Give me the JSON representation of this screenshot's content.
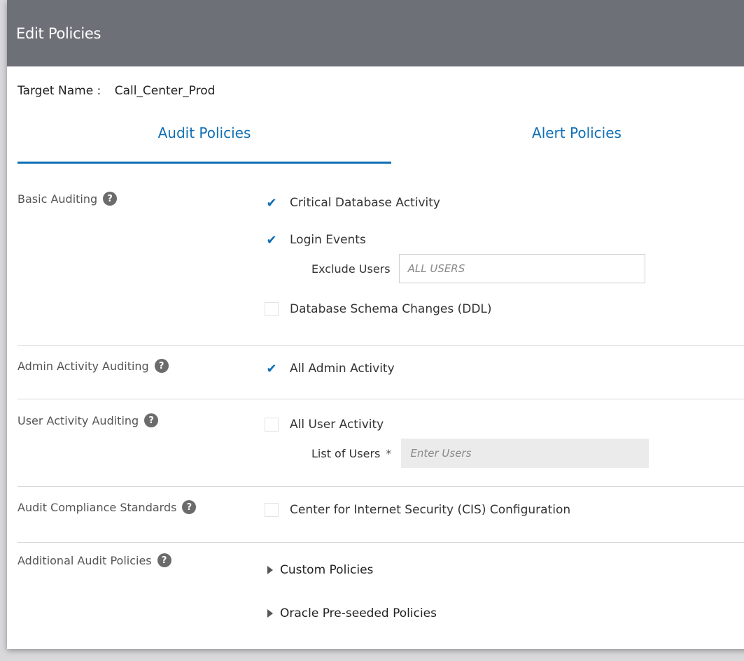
{
  "dialog": {
    "title": "Edit Policies"
  },
  "target": {
    "label": "Target Name :",
    "value": "Call_Center_Prod"
  },
  "tabs": [
    {
      "label": "Audit Policies",
      "active": true
    },
    {
      "label": "Alert Policies",
      "active": false
    }
  ],
  "sections": {
    "basic": {
      "label": "Basic Auditing",
      "critical": {
        "label": "Critical Database Activity",
        "checked": true
      },
      "login": {
        "label": "Login Events",
        "checked": true
      },
      "exclude_users": {
        "label": "Exclude Users",
        "placeholder": "ALL USERS"
      },
      "ddl": {
        "label": "Database Schema Changes (DDL)",
        "checked": false
      }
    },
    "admin": {
      "label": "Admin Activity Auditing",
      "all_admin": {
        "label": "All Admin Activity",
        "checked": true
      }
    },
    "user": {
      "label": "User Activity Auditing",
      "all_user": {
        "label": "All User Activity",
        "checked": false
      },
      "list_users": {
        "label": "List of Users",
        "required_mark": "*",
        "placeholder": "Enter Users"
      }
    },
    "compliance": {
      "label": "Audit Compliance Standards",
      "cis": {
        "label": "Center for Internet Security (CIS) Configuration",
        "checked": false
      }
    },
    "additional": {
      "label": "Additional Audit Policies",
      "custom": {
        "label": "Custom Policies"
      },
      "preseeded": {
        "label": "Oracle Pre-seeded Policies"
      }
    }
  },
  "help_glyph": "?",
  "check_glyph": "✔",
  "icons": {
    "help": "help-icon",
    "check": "checkmark-icon",
    "expand": "triangle-right-icon"
  },
  "colors": {
    "titlebar": "#6e7078",
    "accent": "#0f6fb5"
  }
}
